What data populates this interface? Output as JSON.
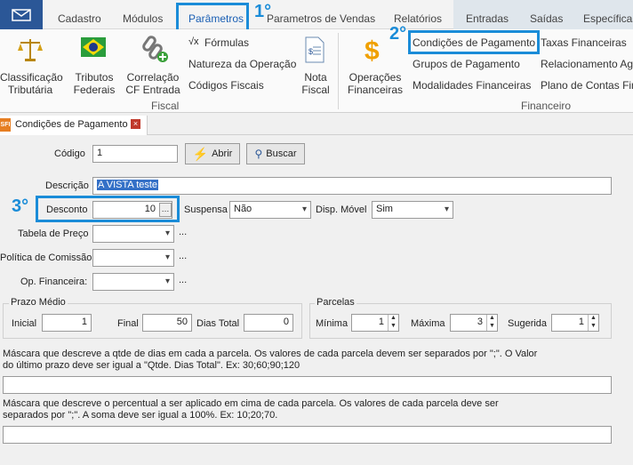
{
  "menu": {
    "tabs": [
      "Cadastro",
      "Módulos",
      "Parâmetros",
      "Parametros de Vendas",
      "Relatórios",
      "Entradas",
      "Saídas",
      "Específicas"
    ]
  },
  "ribbon": {
    "fiscal_items": [
      {
        "label": "Classificação\nTributária",
        "icon": "scale-icon"
      },
      {
        "label": "Tributos\nFederais",
        "icon": "brazil-flag-icon"
      },
      {
        "label": "Correlação\nCF Entrada",
        "icon": "link-add-icon"
      }
    ],
    "fiscal_list": [
      "Fórmulas",
      "Natureza da Operação",
      "Códigos Fiscais"
    ],
    "nota_fiscal": "Nota\nFiscal",
    "fiscal_group": "Fiscal",
    "operacoes": "Operações\nFinanceiras",
    "fin_col1": [
      "Condições de Pagamento",
      "Grupos de Pagamento",
      "Modalidades Financeiras"
    ],
    "fin_col2": [
      "Taxas Financeiras",
      "Relacionamento Ag",
      "Plano de Contas Fin"
    ],
    "financeiro_group": "Financeiro"
  },
  "doc_tab": {
    "title": "Condições de Pagamento",
    "badge": "SFI"
  },
  "form": {
    "codigo_label": "Código",
    "codigo_value": "1",
    "abrir": "Abrir",
    "buscar": "Buscar",
    "descricao_label": "Descrição",
    "descricao_value": "A VISTA teste",
    "desconto_label": "Desconto",
    "desconto_value": "10",
    "suspensa_label": "Suspensa",
    "suspensa_value": "Não",
    "disp_movel_label": "Disp. Móvel",
    "disp_movel_value": "Sim",
    "tabela_label": "Tabela de Preço",
    "politica_label": "Política de Comissão",
    "op_fin_label": "Op. Financeira:",
    "ellipsis": "...",
    "prazo_title": "Prazo Médio",
    "inicial_label": "Inicial",
    "inicial_value": "1",
    "final_label": "Final",
    "final_value": "50",
    "dias_total_label": "Dias Total",
    "dias_total_value": "0",
    "parcelas_title": "Parcelas",
    "minima_label": "Mínima",
    "minima_value": "1",
    "maxima_label": "Máxima",
    "maxima_value": "3",
    "sugerida_label": "Sugerida",
    "sugerida_value": "1",
    "mascara1_text": "Máscara que descreve a qtde de dias em cada  a parcela. Os valores de cada parcela devem ser separados por \";\". O Valor\ndo último prazo deve ser igual a \"Qtde. Dias Total\". Ex: 30;60;90;120",
    "mascara2_text": "Máscara que descreve o percentual a ser aplicado em cima de cada parcela. Os valores de cada parcela deve ser\nseparados por \";\". A soma deve ser igual a 100%. Ex: 10;20;70."
  },
  "annotations": {
    "step1": "1°",
    "step2": "2°",
    "step3": "3°"
  },
  "colors": {
    "highlight": "#1a8cd8",
    "mail_bg": "#2b5797",
    "selection": "#3470c7"
  }
}
